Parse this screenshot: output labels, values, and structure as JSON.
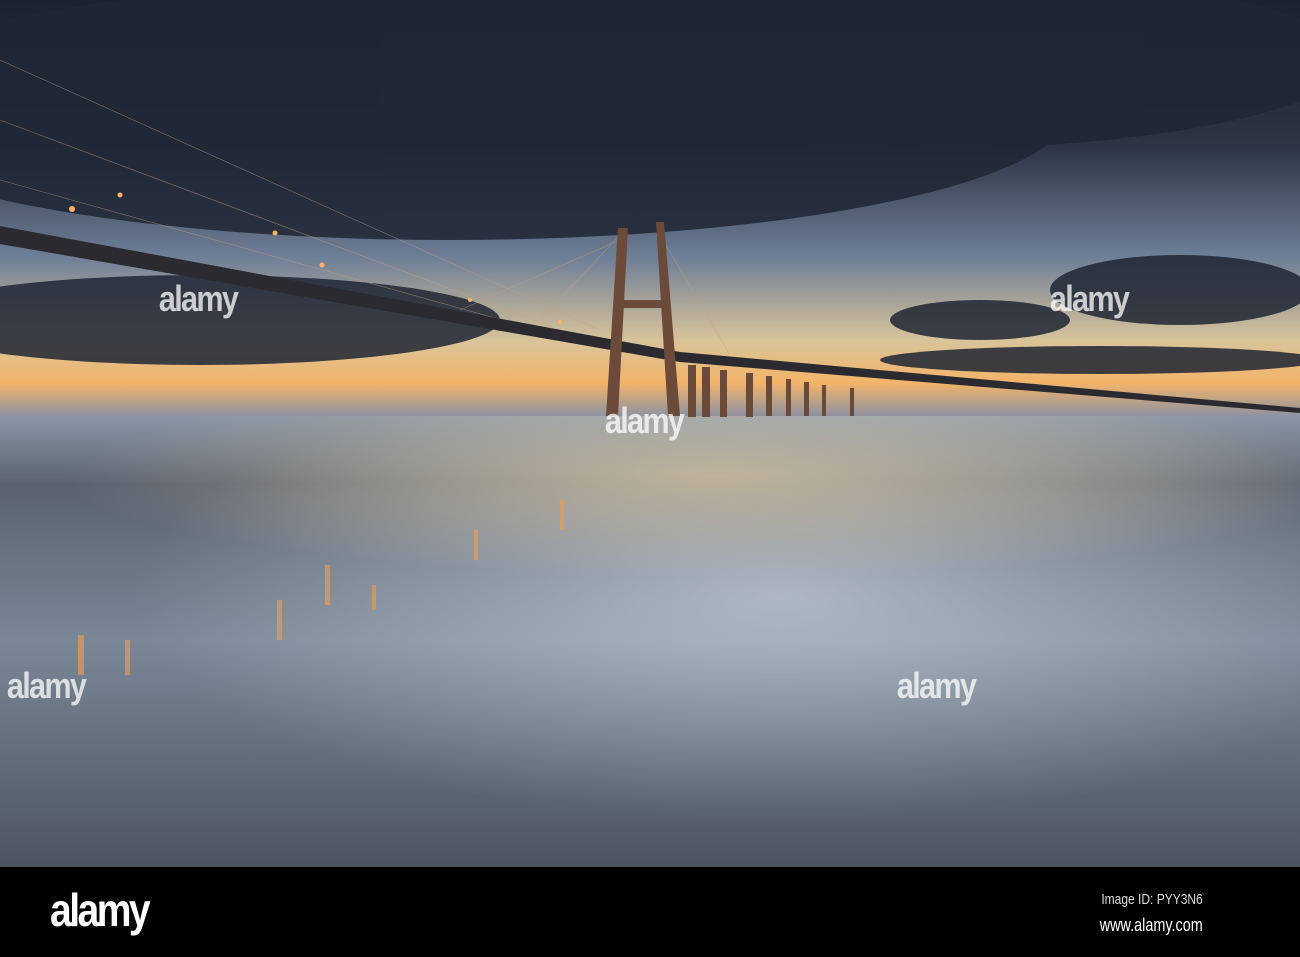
{
  "footer": {
    "logo": "alamy",
    "image_id": "Image ID: PYY3N6",
    "website": "www.alamy.com"
  },
  "watermark": "alamy",
  "colors": {
    "sky_dark": "#1e2533",
    "horizon": "#f0b870",
    "water": "#6f7d8c",
    "footer": "#000000"
  }
}
